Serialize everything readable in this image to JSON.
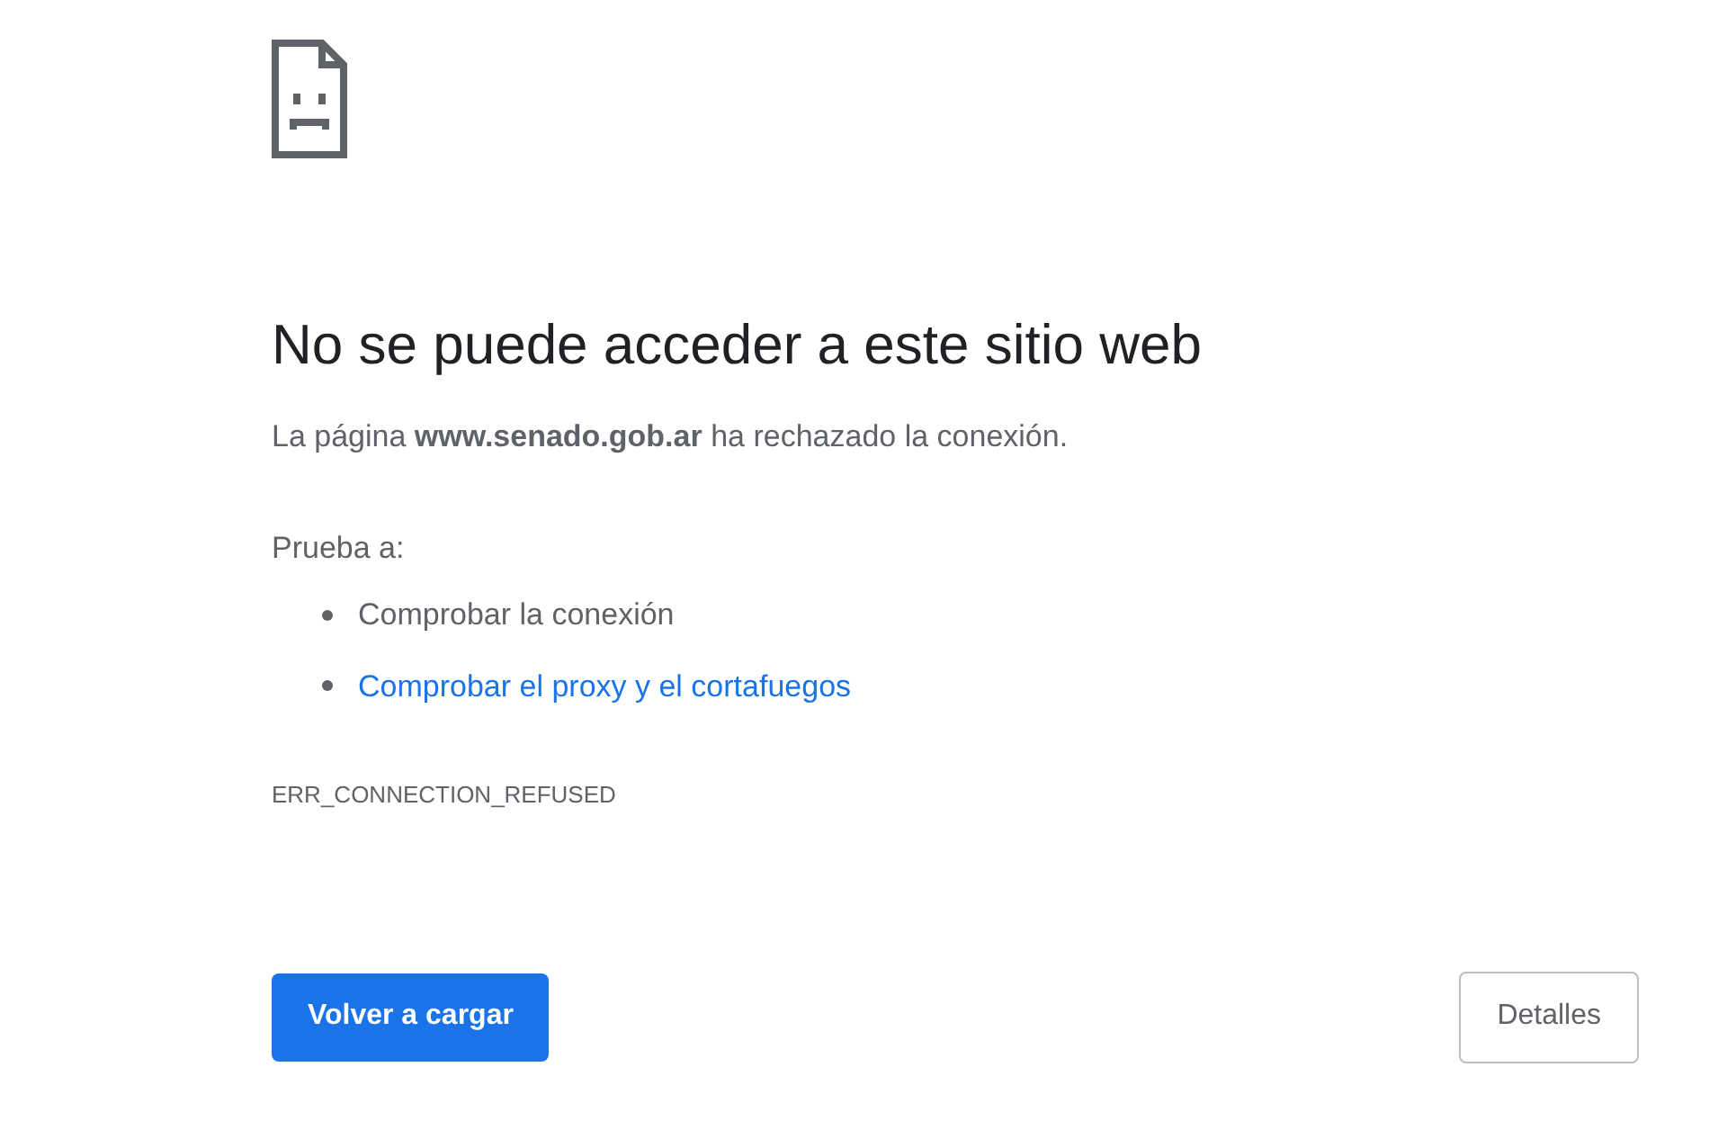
{
  "heading": "No se puede acceder a este sitio web",
  "message": "La página **www.senado.gob.ar** ha rechazado la conexión.",
  "suggestions_label": "Prueba a:",
  "suggestions": [
    {
      "kind": "text",
      "text": "Comprobar la conexión"
    },
    {
      "kind": "link",
      "text": "Comprobar el proxy y el cortafuegos"
    }
  ],
  "error_code": "ERR_CONNECTION_REFUSED",
  "reload_button": "Volver a cargar",
  "details_button": "Detalles"
}
